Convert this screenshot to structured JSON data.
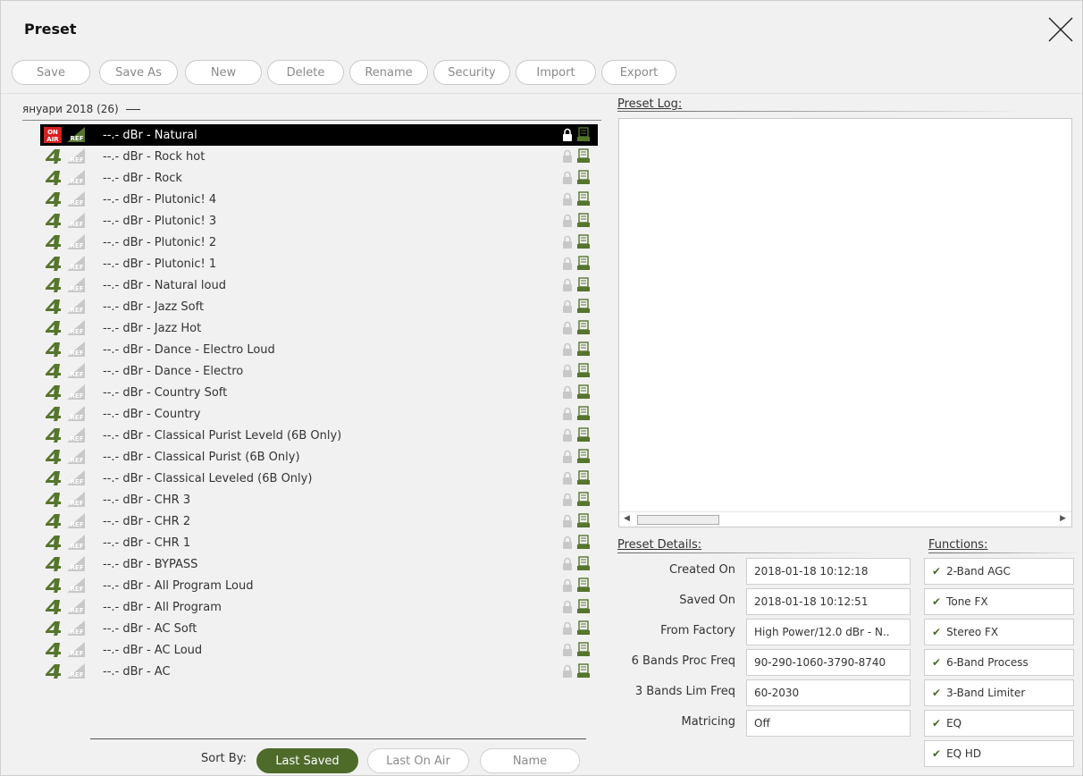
{
  "window": {
    "title": "Preset"
  },
  "toolbar": {
    "buttons": [
      "Save",
      "Save As",
      "New",
      "Delete",
      "Rename",
      "Security",
      "Import",
      "Export"
    ]
  },
  "group": {
    "name": "януари 2018 (26)"
  },
  "presets": [
    {
      "label": "--.- dBr -  Natural",
      "selected": true
    },
    {
      "label": "--.- dBr -  Rock hot"
    },
    {
      "label": "--.- dBr -  Rock"
    },
    {
      "label": "--.- dBr -  Plutonic! 4"
    },
    {
      "label": "--.- dBr -  Plutonic! 3"
    },
    {
      "label": "--.- dBr -  Plutonic! 2"
    },
    {
      "label": "--.- dBr -  Plutonic! 1"
    },
    {
      "label": "--.- dBr -  Natural loud"
    },
    {
      "label": "--.- dBr -  Jazz Soft"
    },
    {
      "label": "--.- dBr -  Jazz Hot"
    },
    {
      "label": "--.- dBr -  Dance - Electro Loud"
    },
    {
      "label": "--.- dBr -  Dance - Electro"
    },
    {
      "label": "--.- dBr -  Country Soft"
    },
    {
      "label": "--.- dBr -  Country"
    },
    {
      "label": "--.- dBr -  Classical Purist Leveld (6B Only)"
    },
    {
      "label": "--.- dBr -  Classical Purist (6B Only)"
    },
    {
      "label": "--.- dBr -  Classical Leveled (6B Only)"
    },
    {
      "label": "--.- dBr -  CHR 3"
    },
    {
      "label": "--.- dBr -  CHR 2"
    },
    {
      "label": "--.- dBr -  CHR 1"
    },
    {
      "label": "--.- dBr -  BYPASS"
    },
    {
      "label": "--.- dBr -  All Program Loud"
    },
    {
      "label": "--.- dBr -  All Program"
    },
    {
      "label": "--.- dBr -  AC Soft"
    },
    {
      "label": "--.- dBr -  AC Loud"
    },
    {
      "label": "--.- dBr -  AC"
    }
  ],
  "icons": {
    "on_air": "ON AIR",
    "ref": "REF",
    "lock": "lock-icon",
    "save": "save-icon"
  },
  "sort": {
    "label": "Sort By:",
    "options": [
      "Last Saved",
      "Last On Air",
      "Name"
    ],
    "active": "Last Saved"
  },
  "log": {
    "label": "Preset Log:"
  },
  "details": {
    "label": "Preset Details:",
    "rows": [
      {
        "key": "Created On",
        "value": "2018-01-18 10:12:18"
      },
      {
        "key": "Saved On",
        "value": "2018-01-18 10:12:51"
      },
      {
        "key": "From Factory",
        "value": "High Power/12.0 dBr - N.."
      },
      {
        "key": "6 Bands Proc Freq",
        "value": "90-290-1060-3790-8740"
      },
      {
        "key": "3 Bands Lim Freq",
        "value": "60-2030"
      },
      {
        "key": "Matricing",
        "value": "Off"
      }
    ]
  },
  "functions": {
    "label": "Functions:",
    "items": [
      "2-Band AGC",
      "Tone FX",
      "Stereo FX",
      "6-Band Process",
      "3-Band Limiter",
      "EQ",
      "EQ HD"
    ]
  },
  "colors": {
    "accent": "#4e6b2a",
    "icon_green": "#56752d",
    "onair_red": "#d42020"
  }
}
